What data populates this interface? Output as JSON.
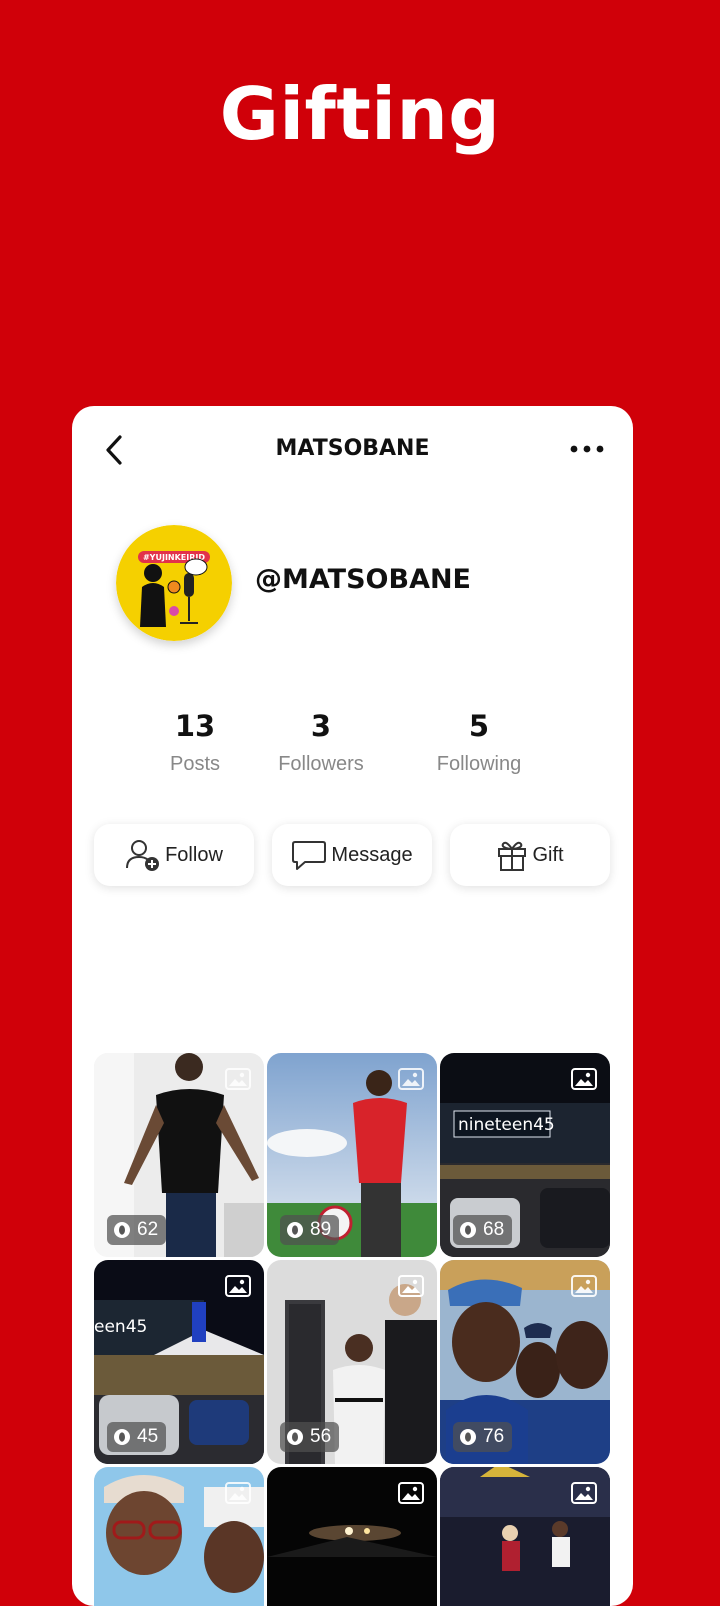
{
  "hero_title": "Gifting",
  "profile": {
    "screen_title": "MATSOBANE",
    "handle": "@MATSOBANE",
    "avatar_caption": "#YUJINKEIRID"
  },
  "stats": [
    {
      "count": "13",
      "label": "Posts"
    },
    {
      "count": "3",
      "label": "Followers"
    },
    {
      "count": "5",
      "label": "Following"
    }
  ],
  "actions": {
    "follow": "Follow",
    "message": "Message",
    "gift": "Gift"
  },
  "posts": [
    {
      "views": "62",
      "scene": "man-black-shirt-indoor"
    },
    {
      "views": "89",
      "scene": "football-player-red-kit"
    },
    {
      "views": "68",
      "scene": "nineteen45-restaurant-night"
    },
    {
      "views": "45",
      "scene": "restaurant-parking-night"
    },
    {
      "views": "56",
      "scene": "two-men-hallway"
    },
    {
      "views": "76",
      "scene": "group-selfie-cap"
    },
    {
      "views": "",
      "scene": "woman-glasses-selfie"
    },
    {
      "views": "",
      "scene": "night-road"
    },
    {
      "views": "",
      "scene": "stadium-crowd"
    }
  ],
  "colors": {
    "background": "#d00009",
    "card": "#ffffff",
    "avatar_bg": "#f5d000"
  },
  "icons": [
    "back-arrow-icon",
    "more-dots-icon",
    "add-user-icon",
    "chat-bubble-icon",
    "gift-icon",
    "image-icon",
    "eye-icon"
  ]
}
